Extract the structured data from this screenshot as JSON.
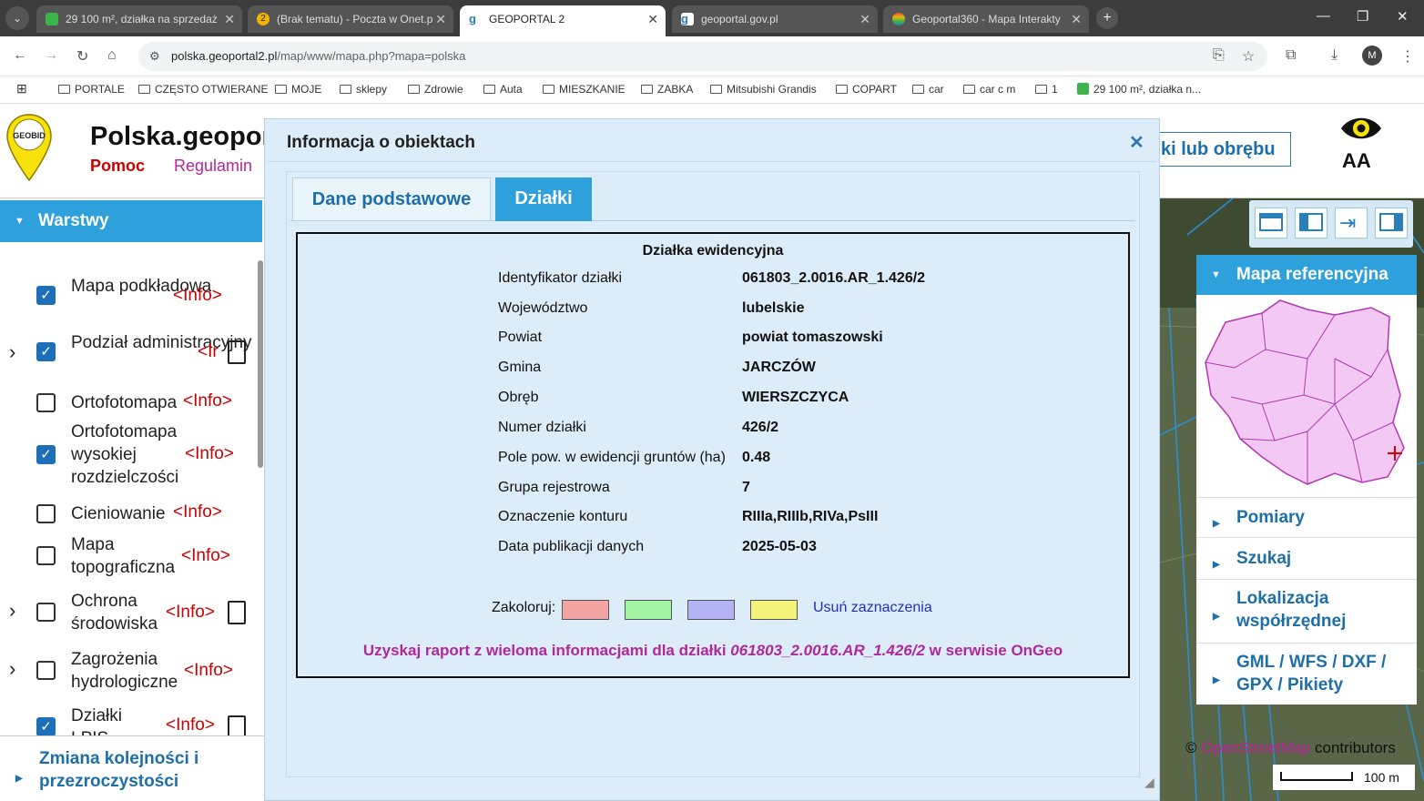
{
  "browser": {
    "tabs": [
      {
        "title": "29 100 m², działka na sprzedaż",
        "color": "#3bb54a",
        "active": false
      },
      {
        "title": "(Brak tematu) - Poczta w Onet.p",
        "color": "#f0b400",
        "badge": "2",
        "active": false
      },
      {
        "title": "GEOPORTAL 2",
        "color": "#2a7fb6",
        "active": true
      },
      {
        "title": "geoportal.gov.pl",
        "color": "#2a7fb6",
        "active": false
      },
      {
        "title": "Geoportal360 - Mapa Interakty",
        "color": "#e04848",
        "active": false
      }
    ],
    "url_host": "polska.geoportal2.pl",
    "url_path": "/map/www/mapa.php?mapa=polska",
    "profile_initial": "M",
    "bookmarks": [
      "PORTALE",
      "CZĘSTO OTWIERANE",
      "MOJE",
      "sklepy",
      "Zdrowie",
      "Auta",
      "MIESZKANIE",
      "ZABKA",
      "Mitsubishi Grandis",
      "COPART",
      "car",
      "car c m",
      "1",
      "29 100 m², działka n..."
    ]
  },
  "header": {
    "logo_text": "GEOBID",
    "title": "Polska.geopor",
    "link_help": "Pomoc",
    "link_rules": "Regulamin",
    "search_button": "ki lub obrębu",
    "font_size_label": "AA"
  },
  "layers_panel": {
    "title": "Warstwy",
    "layers": [
      {
        "name": "Mapa podkładowa",
        "info": "<Info>",
        "checked": true,
        "expandable": false,
        "doc": false
      },
      {
        "name": "Podział administracyjny",
        "info": "<Ir",
        "checked": true,
        "expandable": true,
        "doc": true
      },
      {
        "name": "Ortofotomapa",
        "info": "<Info>",
        "checked": false,
        "expandable": false,
        "doc": false
      },
      {
        "name": "Ortofotomapa wysokiej rozdzielczości",
        "info": "<Info>",
        "checked": true,
        "expandable": false,
        "doc": false
      },
      {
        "name": "Cieniowanie",
        "info": "<Info>",
        "checked": false,
        "expandable": false,
        "doc": false
      },
      {
        "name": "Mapa topograficzna",
        "info": "<Info>",
        "checked": false,
        "expandable": false,
        "doc": false
      },
      {
        "name": "Ochrona środowiska",
        "info": "<Info>",
        "checked": false,
        "expandable": true,
        "doc": true
      },
      {
        "name": "Zagrożenia hydrologiczne",
        "info": "<Info>",
        "checked": false,
        "expandable": true,
        "doc": false
      },
      {
        "name": "Działki LPIS",
        "info": "<Info>",
        "checked": true,
        "expandable": false,
        "doc": true
      }
    ],
    "order_link": "Zmiana kolejności i przezroczystości"
  },
  "dialog": {
    "title": "Informacja o obiektach",
    "tabs": [
      "Dane podstawowe",
      "Działki"
    ],
    "active_tab": "Działki",
    "box_title": "Działka ewidencyjna",
    "rows": [
      {
        "key": "Identyfikator działki",
        "value": "061803_2.0016.AR_1.426/2"
      },
      {
        "key": "Województwo",
        "value": "lubelskie"
      },
      {
        "key": "Powiat",
        "value": "powiat tomaszowski"
      },
      {
        "key": "Gmina",
        "value": "JARCZÓW"
      },
      {
        "key": "Obręb",
        "value": "WIERSZCZYCA"
      },
      {
        "key": "Numer działki",
        "value": "426/2"
      },
      {
        "key": "Pole pow. w ewidencji gruntów (ha)",
        "value": "0.48"
      },
      {
        "key": "Grupa rejestrowa",
        "value": "7"
      },
      {
        "key": "Oznaczenie konturu",
        "value": "RIIIa,RIIIb,RIVa,PsIII"
      },
      {
        "key": "Data publikacji danych",
        "value": "2025-05-03"
      }
    ],
    "color_label": "Zakoloruj:",
    "swatches": [
      "#f4a3a3",
      "#a3f4a3",
      "#b3b3f4",
      "#f4f47a"
    ],
    "clear_link": "Usuń zaznaczenia",
    "report_prefix": "Uzyskaj raport z wieloma informacjami dla działki",
    "report_id": "061803_2.0016.AR_1.426/2",
    "report_suffix": "w serwisie OnGeo"
  },
  "right_panel": {
    "ref_title": "Mapa referencyjna",
    "items": [
      "Pomiary",
      "Szukaj",
      "Lokalizacja współrzędnej",
      "GML / WFS / DXF / GPX / Pikiety"
    ]
  },
  "map": {
    "attribution_prefix": "©",
    "attribution_link": "OpenStreetMap",
    "attribution_suffix": "contributors",
    "scale": "100 m"
  }
}
